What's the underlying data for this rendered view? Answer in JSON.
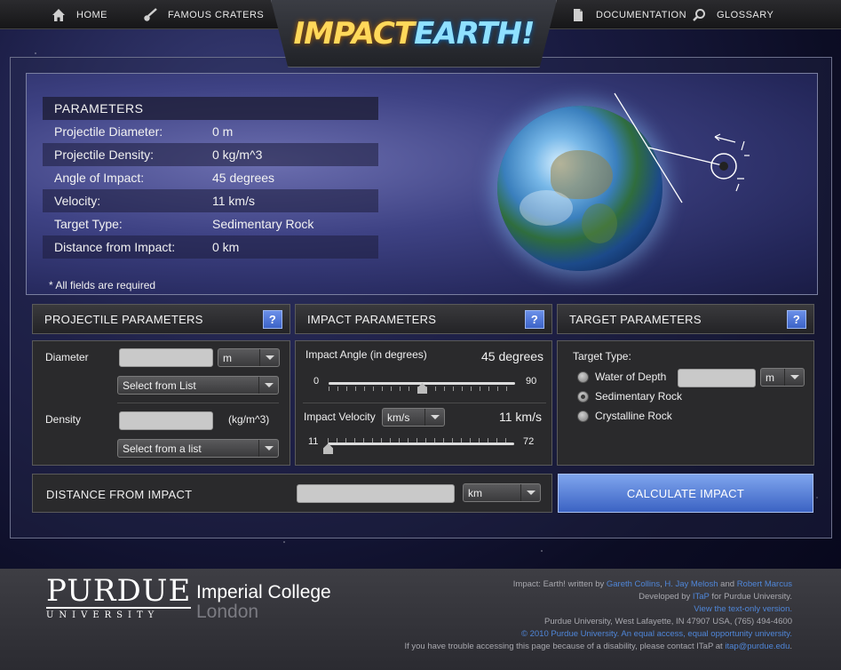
{
  "nav": {
    "home": "HOME",
    "famous_craters": "FAMOUS CRATERS",
    "documentation": "DOCUMENTATION",
    "glossary": "GLOSSARY"
  },
  "logo": {
    "part1": "IMPACT",
    "part2": "EARTH!"
  },
  "summary": {
    "heading": "PARAMETERS",
    "rows": [
      {
        "label": "Projectile Diameter:",
        "value": "0 m"
      },
      {
        "label": "Projectile Density:",
        "value": "0 kg/m^3"
      },
      {
        "label": "Angle of Impact:",
        "value": "45 degrees"
      },
      {
        "label": "Velocity:",
        "value": "11 km/s"
      },
      {
        "label": "Target Type:",
        "value": "Sedimentary Rock"
      },
      {
        "label": "Distance from Impact:",
        "value": "0 km"
      }
    ],
    "required_note": "* All fields are required"
  },
  "projectile": {
    "title": "PROJECTILE PARAMETERS",
    "help": "?",
    "diameter_label": "Diameter",
    "diameter_value": "",
    "diameter_unit": "m",
    "diameter_list": "Select from List",
    "density_label": "Density",
    "density_value": "",
    "density_unit": "(kg/m^3)",
    "density_list": "Select from a list"
  },
  "impact": {
    "title": "IMPACT PARAMETERS",
    "help": "?",
    "angle_label": "Impact Angle (in degrees)",
    "angle_display": "45 degrees",
    "angle_min": "0",
    "angle_max": "90",
    "angle_value": 45,
    "velocity_label": "Impact Velocity",
    "velocity_unit": "km/s",
    "velocity_display": "11 km/s",
    "velocity_min": "11",
    "velocity_max": "72",
    "velocity_value": 11
  },
  "target": {
    "title": "TARGET PARAMETERS",
    "help": "?",
    "type_label": "Target Type:",
    "water_label": "Water of Depth",
    "water_value": "",
    "water_unit": "m",
    "sedimentary_label": "Sedimentary Rock",
    "crystalline_label": "Crystalline Rock",
    "selected": "Sedimentary Rock"
  },
  "distance": {
    "label": "DISTANCE FROM IMPACT",
    "value": "",
    "unit": "km"
  },
  "calculate_label": "CALCULATE IMPACT",
  "footer": {
    "purdue_big": "PURDUE",
    "purdue_small": "UNIVERSITY",
    "imperial": "Imperial College",
    "london": "London",
    "credit_prefix": "Impact: Earth! written by ",
    "author1": "Gareth Collins",
    "sep1": ", ",
    "author2": "H. Jay Melosh",
    "sep2": " and ",
    "author3": "Robert Marcus",
    "developed_prefix": "Developed by ",
    "itap": "ITaP",
    "developed_suffix": " for Purdue University.",
    "text_only": "View the text-only version.",
    "address": "Purdue University, West Lafayette, IN 47907 USA, (765) 494-4600",
    "copyright": "© 2010 Purdue University.",
    "equal_access": "An equal access, equal opportunity university.",
    "trouble_prefix": "If you have trouble accessing this page because of a disability, please contact ITaP at ",
    "email": "itap@purdue.edu",
    "trouble_suffix": "."
  }
}
